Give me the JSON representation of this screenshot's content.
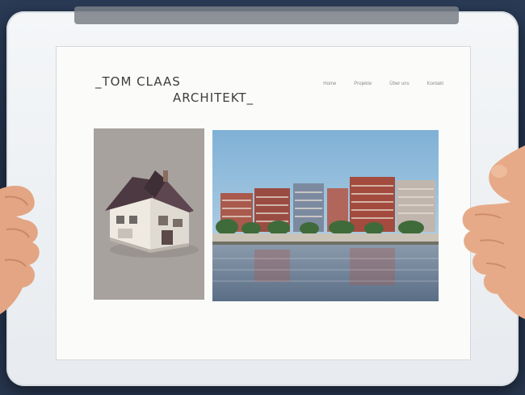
{
  "site": {
    "logo_line1": "_TOM CLAAS",
    "logo_line2": "ARCHITEKT_"
  },
  "nav": {
    "items": [
      {
        "label": "Home"
      },
      {
        "label": "Projekte"
      },
      {
        "label": "Über uns"
      },
      {
        "label": "Kontakt"
      }
    ]
  },
  "colors": {
    "panel_gray": "#a7a29e",
    "sky": "#9fc3dd",
    "water": "#6a7f95",
    "building_brick": "#a34b3e"
  },
  "icons": {
    "house_render": "house-render-image",
    "waterfront_photo": "waterfront-buildings-image"
  }
}
